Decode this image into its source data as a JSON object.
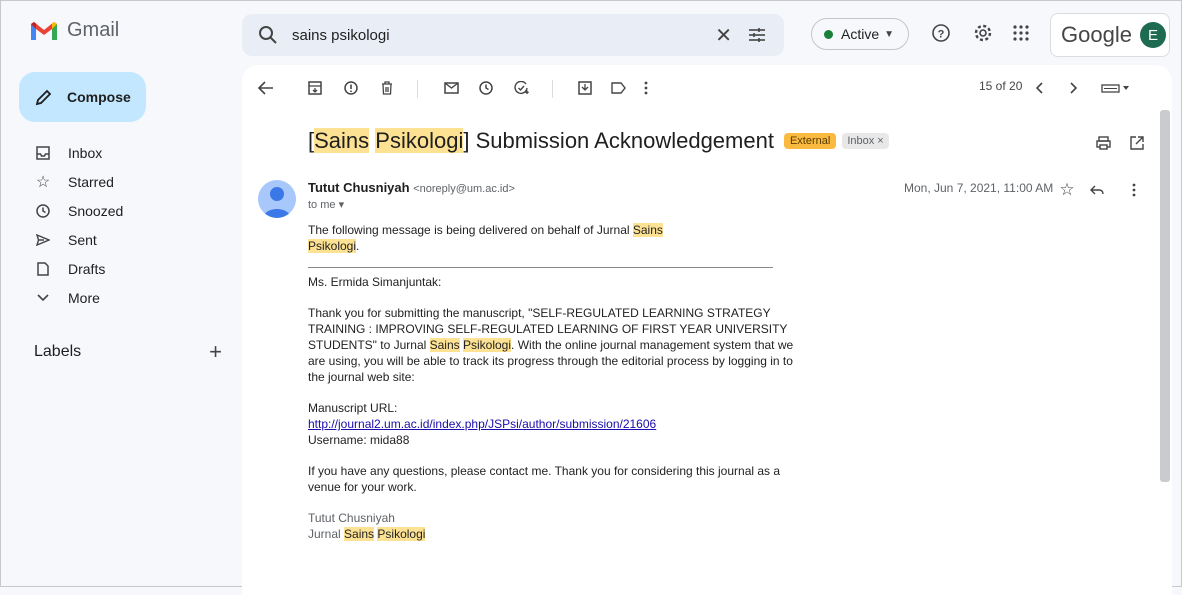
{
  "app": {
    "name": "Gmail"
  },
  "search": {
    "value": "sains psikologi"
  },
  "status": {
    "label": "Active"
  },
  "account": {
    "brand": "Google",
    "avatar_letter": "E"
  },
  "sidebar": {
    "compose_label": "Compose",
    "items": [
      {
        "icon": "inbox-icon",
        "label": "Inbox"
      },
      {
        "icon": "star-icon",
        "label": "Starred"
      },
      {
        "icon": "clock-icon",
        "label": "Snoozed"
      },
      {
        "icon": "send-icon",
        "label": "Sent"
      },
      {
        "icon": "draft-icon",
        "label": "Drafts"
      },
      {
        "icon": "chevron-down-icon",
        "label": "More"
      }
    ],
    "labels_heading": "Labels"
  },
  "toolbar": {
    "pager": "15 of 20"
  },
  "email": {
    "subject_prefix": "[",
    "subject_hl1": "Sains",
    "subject_hl2": "Psikologi",
    "subject_rest": "] Submission Acknowledgement",
    "badge_external": "External",
    "badge_inbox": "Inbox ×",
    "sender_name": "Tutut Chusniyah",
    "sender_email": "<noreply@um.ac.id>",
    "to_me": "to me ▾",
    "date": "Mon, Jun 7, 2021, 11:00 AM",
    "body": {
      "p1_a": "The following message is being delivered on behalf of Jurnal ",
      "p1_hl1": "Sains",
      "p1_hl2": "Psikologi",
      "p1_end": ".",
      "greeting": "Ms. Ermida Simanjuntak:",
      "p2_a": "Thank you for submitting the manuscript, \"SELF-REGULATED LEARNING STRATEGY TRAINING : IMPROVING SELF-REGULATED LEARNING OF  FIRST YEAR UNIVERSITY STUDENTS\" to Jurnal ",
      "p2_hl1": "Sains",
      "p2_hl2": "Psikologi",
      "p2_b": ". With the online journal management system that we are using, you will be able to track its progress through the editorial process by logging in to the journal web site:",
      "url_label": "Manuscript URL:",
      "url": "http://journal2.um.ac.id/index.php/JSPsi/author/submission/21606",
      "username": "Username: mida88",
      "p3": "If you have any questions, please contact me. Thank you for considering this journal as a venue for your work.",
      "sig_name": "Tutut Chusniyah",
      "sig_journal": "Jurnal ",
      "sig_hl1": "Sains",
      "sig_hl2": "Psikologi"
    }
  },
  "colors": {
    "compose_bg": "#c2e7ff",
    "highlight": "#fde293",
    "external_badge": "#f9ba3f",
    "active_dot": "#188038"
  }
}
